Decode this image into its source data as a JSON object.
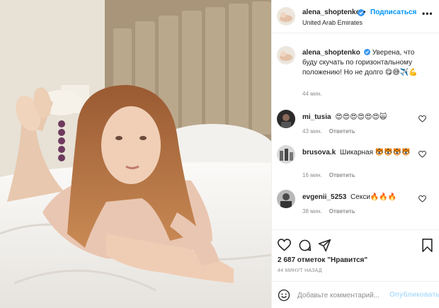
{
  "colors": {
    "accent": "#0095f6",
    "verified": "#3897f0",
    "muted": "#8e8e8e",
    "publish_disabled": "#b2dffc"
  },
  "photo": {
    "alt": ""
  },
  "header": {
    "username": "alena_shoptenko",
    "dot": "•",
    "follow_label": "Подписаться",
    "location": "United Arab Emirates",
    "more_icon": "more-horizontal-icon",
    "more_glyph": "•••"
  },
  "caption": {
    "username": "alena_shoptenko",
    "text": "Уверена, что буду скучать по горизонтальному положению! Но не долго 😋😅✈️💪",
    "time": "44 мин."
  },
  "comments": [
    {
      "username": "mi_tusia",
      "text": "😍😍😍😍😍😍🙀",
      "time": "43 мин.",
      "reply": "Ответить"
    },
    {
      "username": "brusova.k",
      "text": "Шикарная 🐯🐯🐯🐯",
      "time": "16 мин.",
      "reply": "Ответить"
    },
    {
      "username": "evgenii_5253",
      "text": "Секси🔥🔥🔥",
      "time": "38 мин.",
      "reply": "Ответить"
    }
  ],
  "actions": {
    "icons": [
      "heart-icon",
      "comment-icon",
      "share-icon",
      "bookmark-icon"
    ],
    "likes_count": "2 687 отметок",
    "likes_word": "\"Нравится\"",
    "time_ago": "44 МИНУТ НАЗАД"
  },
  "add_comment": {
    "placeholder": "Добавьте комментарий...",
    "publish_label": "Опубликовать"
  }
}
